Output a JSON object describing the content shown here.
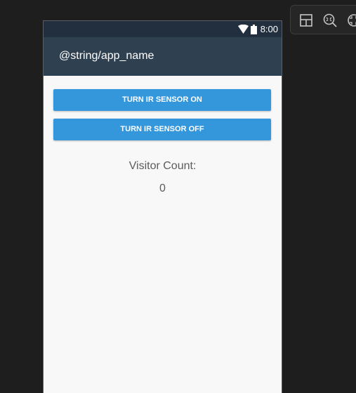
{
  "status_bar": {
    "time": "8:00",
    "icons": [
      "wifi-icon",
      "battery-icon"
    ]
  },
  "app_bar": {
    "title": "@string/app_name"
  },
  "main": {
    "sensor_on_label": "TURN IR SENSOR ON",
    "sensor_off_label": "TURN IR SENSOR OFF",
    "visitor_label": "Visitor Count:",
    "visitor_count": "0"
  },
  "design_toolbar": {
    "icons": [
      "layout-icon",
      "zoom-fit-icon",
      "focus-icon"
    ]
  },
  "colors": {
    "status_bar": "#222f3e",
    "app_bar": "#2f4051",
    "button": "#3497dc",
    "background": "#f8f8f9",
    "ide_background": "#1e1e1e"
  }
}
